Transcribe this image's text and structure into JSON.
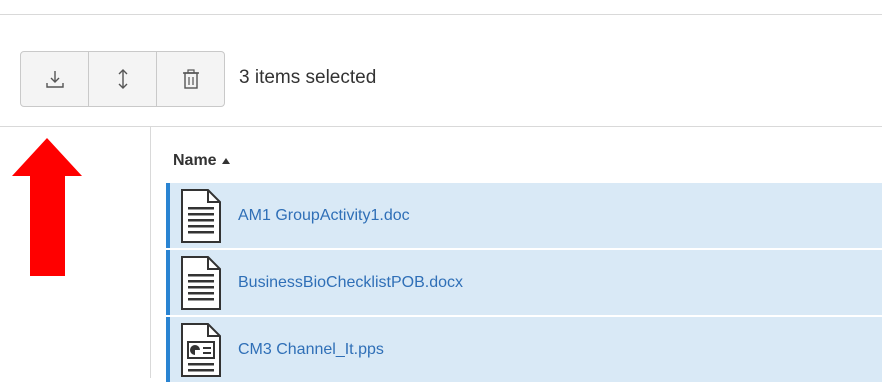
{
  "toolbar": {
    "buttons": [
      {
        "icon": "download-icon"
      },
      {
        "icon": "move-icon"
      },
      {
        "icon": "trash-icon"
      }
    ],
    "selection_status": "3 items selected"
  },
  "table": {
    "name_header": "Name"
  },
  "files": [
    {
      "name": "AM1 GroupActivity1.doc",
      "icon": "document-icon",
      "selected": true
    },
    {
      "name": "BusinessBioChecklistPOB.docx",
      "icon": "document-icon",
      "selected": true
    },
    {
      "name": "CM3 Channel_It.pps",
      "icon": "presentation-icon",
      "selected": true
    }
  ],
  "colors": {
    "selected_row_background": "#d9e9f6",
    "selected_row_border": "#2a84d2",
    "link_text": "#2f6fb7",
    "annotation_arrow": "#ff0000"
  }
}
